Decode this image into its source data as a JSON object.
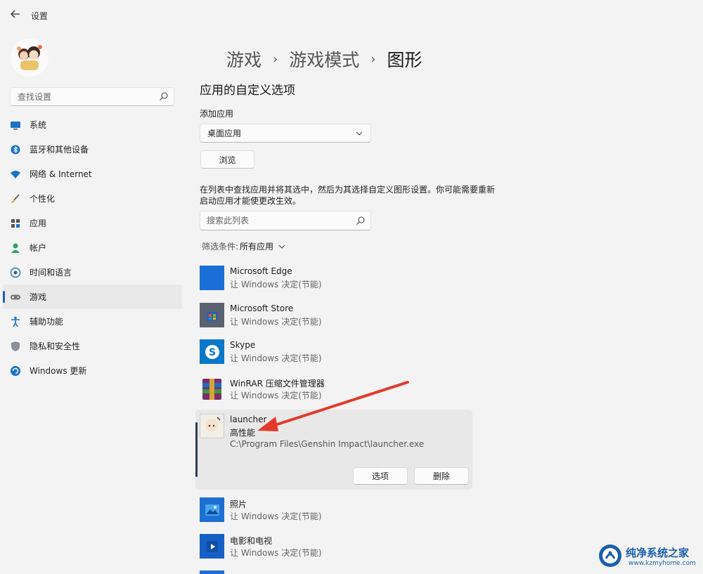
{
  "window": {
    "title": "设置"
  },
  "sidebar": {
    "search_placeholder": "查找设置",
    "items": [
      {
        "label": "系统",
        "icon": "monitor-icon"
      },
      {
        "label": "蓝牙和其他设备",
        "icon": "bluetooth-icon"
      },
      {
        "label": "网络 & Internet",
        "icon": "wifi-icon"
      },
      {
        "label": "个性化",
        "icon": "brush-icon"
      },
      {
        "label": "应用",
        "icon": "apps-icon"
      },
      {
        "label": "帐户",
        "icon": "person-icon"
      },
      {
        "label": "时间和语言",
        "icon": "globe-clock-icon"
      },
      {
        "label": "游戏",
        "icon": "gamepad-icon",
        "active": true
      },
      {
        "label": "辅助功能",
        "icon": "accessibility-icon"
      },
      {
        "label": "隐私和安全性",
        "icon": "shield-icon"
      },
      {
        "label": "Windows 更新",
        "icon": "update-icon"
      }
    ]
  },
  "breadcrumb": {
    "items": [
      "游戏",
      "游戏模式",
      "图形"
    ]
  },
  "main": {
    "section_title": "应用的自定义选项",
    "add_app_label": "添加应用",
    "dropdown_value": "桌面应用",
    "browse_label": "浏览",
    "description": "在列表中查找应用并将其选中，然后为其选择自定义图形设置。你可能需要重新启动应用才能使更改生效。",
    "list_search_placeholder": "搜索此列表",
    "filter_label": "筛选条件:",
    "filter_value": "所有应用"
  },
  "apps": [
    {
      "name": "Microsoft Edge",
      "status": "让 Windows 决定(节能)"
    },
    {
      "name": "Microsoft Store",
      "status": "让 Windows 决定(节能)"
    },
    {
      "name": "Skype",
      "status": "让 Windows 决定(节能)"
    },
    {
      "name": "WinRAR 压缩文件管理器",
      "status": "让 Windows 决定(节能)"
    }
  ],
  "expanded_app": {
    "name": "launcher",
    "status": "高性能",
    "path": "C:\\Program Files\\Genshin Impact\\launcher.exe",
    "options_label": "选项",
    "delete_label": "删除"
  },
  "apps_after": [
    {
      "name": "照片",
      "status": "让 Windows 决定(节能)"
    },
    {
      "name": "电影和电视",
      "status": "让 Windows 决定(节能)"
    }
  ],
  "watermark": {
    "name": "纯净系统之家",
    "url": "www.kzmyhome.com"
  },
  "colors": {
    "accent": "#1d5fb5",
    "annotation_arrow": "#e23b2e",
    "edge_blue": "#1a6fd6"
  }
}
